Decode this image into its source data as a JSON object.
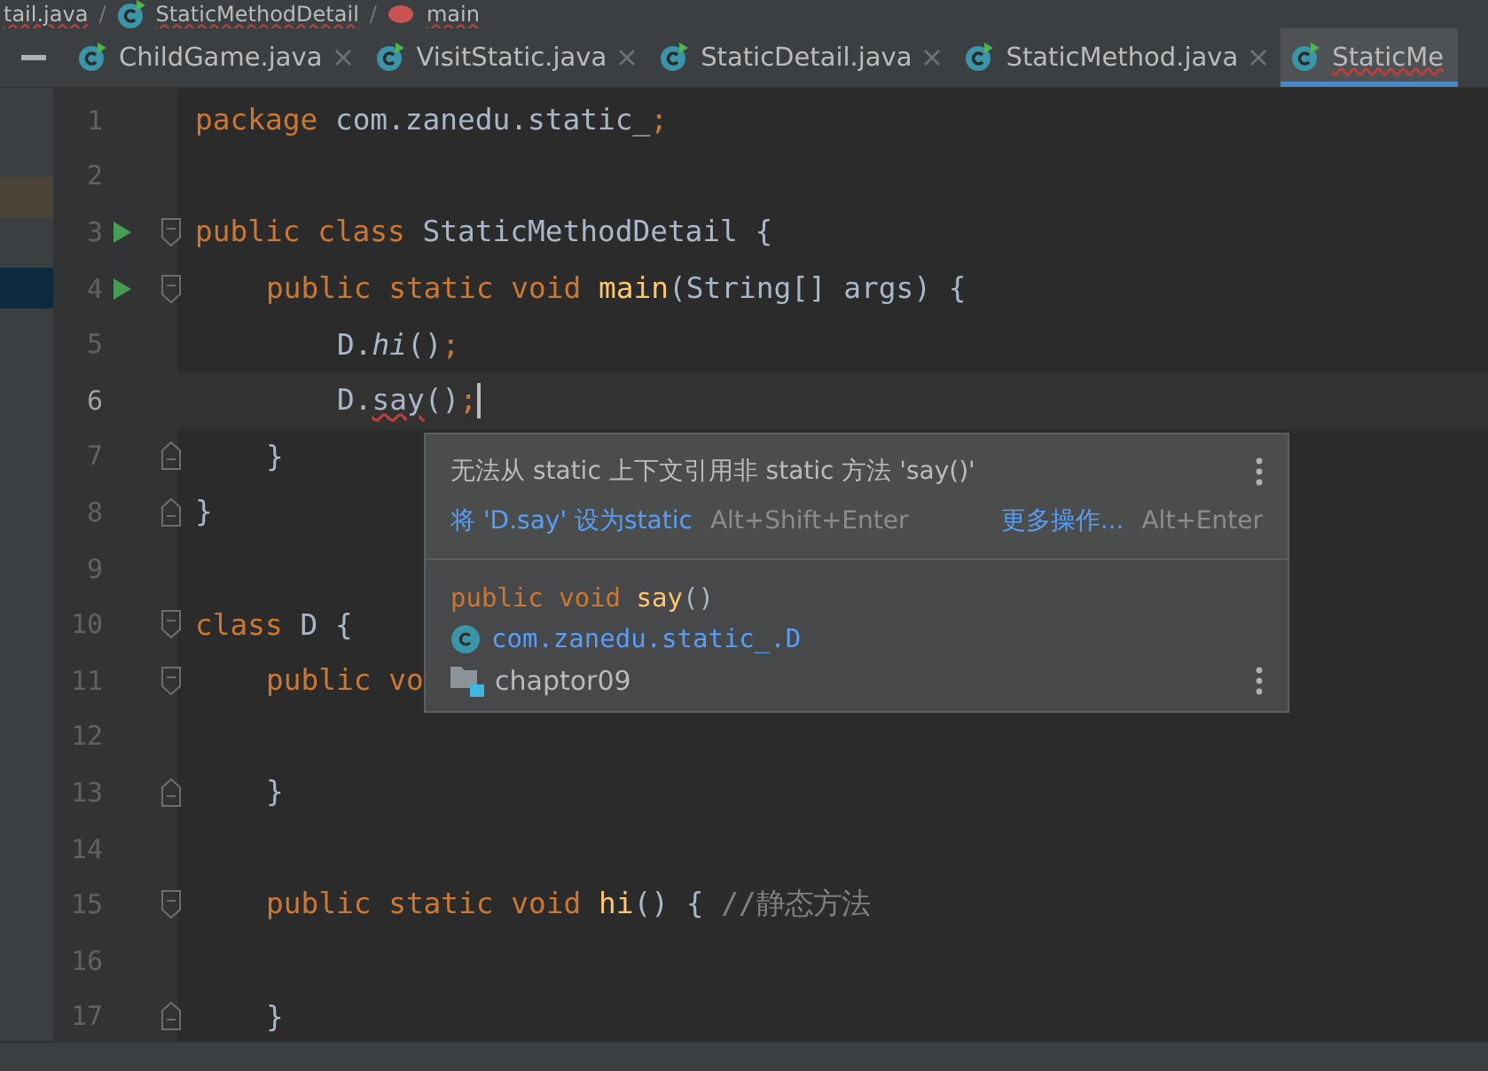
{
  "breadcrumbs": [
    {
      "label": "tail.java",
      "kind": "file"
    },
    {
      "separator": "/",
      "label": "StaticMethodDetail",
      "kind": "class"
    },
    {
      "separator": "/",
      "label": "main",
      "kind": "method"
    }
  ],
  "tabs": [
    {
      "label": "ChildGame.java",
      "selected": false,
      "closable": true
    },
    {
      "label": "VisitStatic.java",
      "selected": false,
      "closable": true
    },
    {
      "label": "StaticDetail.java",
      "selected": false,
      "closable": true
    },
    {
      "label": "StaticMethod.java",
      "selected": false,
      "closable": true
    },
    {
      "label": "StaticMe",
      "selected": true,
      "closable": false
    }
  ],
  "editor": {
    "lines": [
      {
        "number": "1",
        "run": false,
        "current": false,
        "fold_start": false,
        "fold_end": false,
        "tokens": [
          {
            "kind": "keyword",
            "text": "package"
          },
          {
            "kind": "plain",
            "text": " com.zanedu.static_"
          },
          {
            "kind": "keyword",
            "text": ";"
          }
        ]
      },
      {
        "number": "2",
        "run": false,
        "current": false,
        "fold_start": false,
        "fold_end": false
      },
      {
        "number": "3",
        "run": true,
        "current": false,
        "fold_start": true,
        "fold_end": false,
        "tokens": [
          {
            "kind": "keyword",
            "text": "public class"
          },
          {
            "kind": "plain",
            "text": " StaticMethodDetail {"
          }
        ],
        "children": [
          {
            "number": "4",
            "run": true,
            "current": false,
            "fold_start": true,
            "fold_end": false,
            "tokens": [
              {
                "kind": "keyword",
                "text": "public static void "
              },
              {
                "kind": "method",
                "text": "main"
              },
              {
                "kind": "plain",
                "text": "(String[] args) {"
              }
            ],
            "children": [
              {
                "number": "5",
                "run": false,
                "current": false,
                "fold_start": false,
                "fold_end": false,
                "tokens": [
                  {
                    "kind": "plain",
                    "text": "D."
                  },
                  {
                    "kind": "static-call",
                    "text": "hi"
                  },
                  {
                    "kind": "plain",
                    "text": "()"
                  },
                  {
                    "kind": "keyword",
                    "text": ";"
                  }
                ]
              },
              {
                "number": "6",
                "run": false,
                "current": true,
                "fold_start": false,
                "fold_end": false,
                "tokens": [
                  {
                    "kind": "plain",
                    "text": "D."
                  },
                  {
                    "kind": "error",
                    "text": "say"
                  },
                  {
                    "kind": "plain",
                    "text": "()"
                  },
                  {
                    "kind": "keyword",
                    "text": ";"
                  }
                ]
              }
            ]
          },
          {
            "number": "7",
            "run": false,
            "current": false,
            "fold_start": false,
            "fold_end": true,
            "tokens": [
              {
                "kind": "plain",
                "text": "}"
              }
            ]
          }
        ]
      },
      {
        "number": "8",
        "run": false,
        "current": false,
        "fold_start": false,
        "fold_end": true,
        "tokens": [
          {
            "kind": "plain",
            "text": "}"
          }
        ]
      },
      {
        "number": "9",
        "run": false,
        "current": false,
        "fold_start": false,
        "fold_end": false
      },
      {
        "number": "10",
        "run": false,
        "current": false,
        "fold_start": true,
        "fold_end": false,
        "tokens": [
          {
            "kind": "keyword",
            "text": "class"
          },
          {
            "kind": "plain",
            "text": " D {"
          }
        ],
        "children": [
          {
            "number": "11",
            "run": false,
            "current": false,
            "fold_start": true,
            "fold_end": false,
            "tokens": [
              {
                "kind": "keyword",
                "text": "public vo"
              }
            ],
            "children": [
              {
                "number": "12",
                "run": false,
                "current": false,
                "fold_start": false,
                "fold_end": false
              }
            ]
          },
          {
            "number": "13",
            "run": false,
            "current": false,
            "fold_start": false,
            "fold_end": true,
            "tokens": [
              {
                "kind": "plain",
                "text": "}"
              }
            ]
          },
          {
            "number": "14",
            "run": false,
            "current": false,
            "fold_start": false,
            "fold_end": false
          },
          {
            "number": "15",
            "run": false,
            "current": false,
            "fold_start": true,
            "fold_end": false,
            "tokens": [
              {
                "kind": "keyword",
                "text": "public static void "
              },
              {
                "kind": "method",
                "text": "hi"
              },
              {
                "kind": "plain",
                "text": "() { "
              },
              {
                "kind": "comment",
                "text": "//静态方法"
              }
            ],
            "children": [
              {
                "number": "16",
                "run": false,
                "current": false,
                "fold_start": false,
                "fold_end": false
              }
            ]
          },
          {
            "number": "17",
            "run": false,
            "current": false,
            "fold_start": false,
            "fold_end": true,
            "tokens": [
              {
                "kind": "plain",
                "text": "}"
              }
            ]
          }
        ]
      }
    ]
  },
  "popup": {
    "message": "无法从 static 上下文引用非 static 方法 'say()'",
    "fix": {
      "label": "将 'D.say' 设为static",
      "shortcut": "Alt+Shift+Enter"
    },
    "more": {
      "label": "更多操作...",
      "shortcut": "Alt+Enter"
    },
    "signature": [
      {
        "kind": "keyword",
        "text": "public void "
      },
      {
        "kind": "method",
        "text": "say"
      },
      {
        "kind": "plain",
        "text": "()"
      }
    ],
    "class_path": "com.zanedu.static_.D",
    "module": "chaptor09"
  }
}
